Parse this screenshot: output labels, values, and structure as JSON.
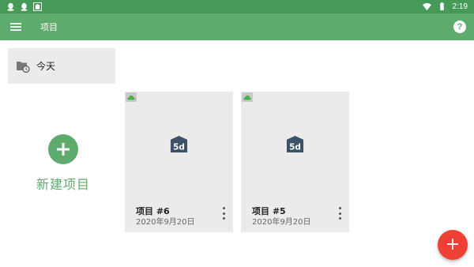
{
  "status_bar": {
    "time": "2:19",
    "left_icons": [
      "qq-icon",
      "qq-icon",
      "5d-app-icon"
    ],
    "right_icons": [
      "wifi-icon",
      "battery-icon"
    ]
  },
  "app_bar": {
    "title": "项目",
    "menu_icon": "hamburger-icon",
    "help_label": "?"
  },
  "folder": {
    "label": "今天",
    "icon": "folder-clock-icon"
  },
  "new_project": {
    "label": "新建项目",
    "icon": "plus-icon"
  },
  "projects": [
    {
      "title": "项目 #6",
      "date": "2020年9月20日"
    },
    {
      "title": "项目 #5",
      "date": "2020年9月20日"
    }
  ],
  "fab": {
    "label": "+"
  },
  "colors": {
    "status_bar": "#459a58",
    "app_bar": "#5dab6d",
    "accent": "#5dab6d",
    "card_bg": "#ebebeb",
    "fab": "#ef4036",
    "logo": "#3d5168"
  }
}
